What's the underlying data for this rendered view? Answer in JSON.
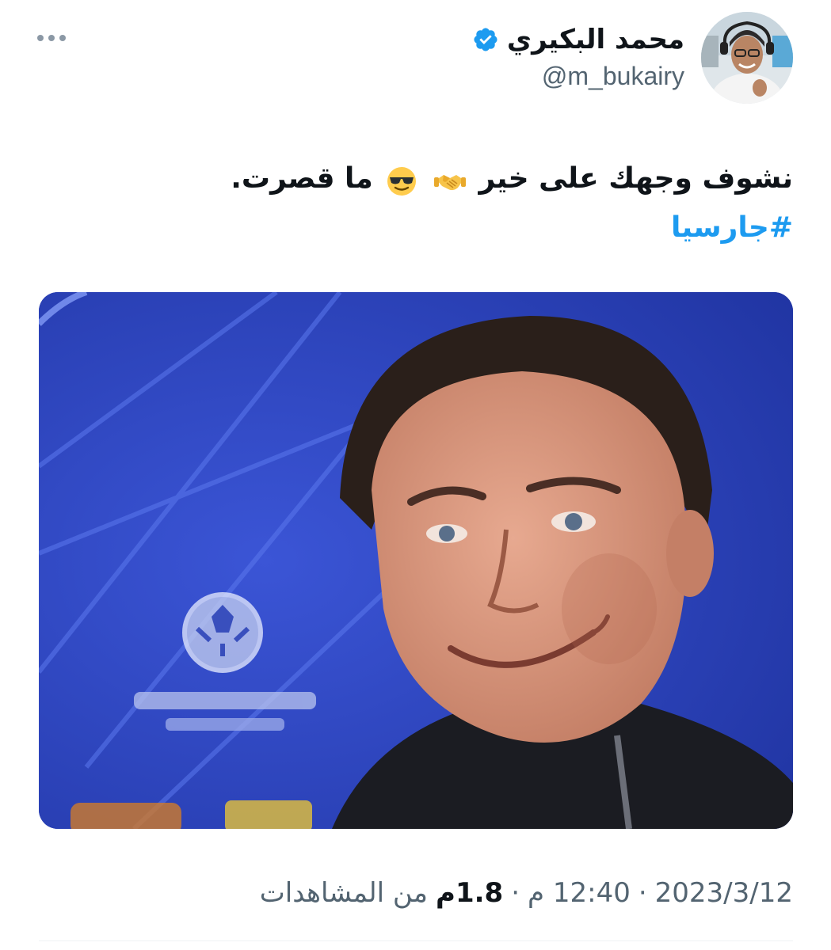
{
  "author": {
    "display_name": "محمد البكيري",
    "handle": "@m_bukairy",
    "verified": true
  },
  "tweet": {
    "text_line1_part1": "نشوف وجهك على خير",
    "text_line1_part2": "ما قصرت.",
    "emojis": [
      "handshake-icon",
      "sunglasses-face-icon"
    ],
    "hashtag": "#جارسيا"
  },
  "media": {
    "alt": "photo"
  },
  "meta": {
    "date": "2023/3/12",
    "separator1": "·",
    "time": "12:40 م",
    "separator2": "·",
    "views_count": "1.8م",
    "views_label": "من المشاهدات"
  },
  "colors": {
    "accent": "#1d9bf0",
    "text": "#0f1419",
    "secondary": "#536471"
  }
}
